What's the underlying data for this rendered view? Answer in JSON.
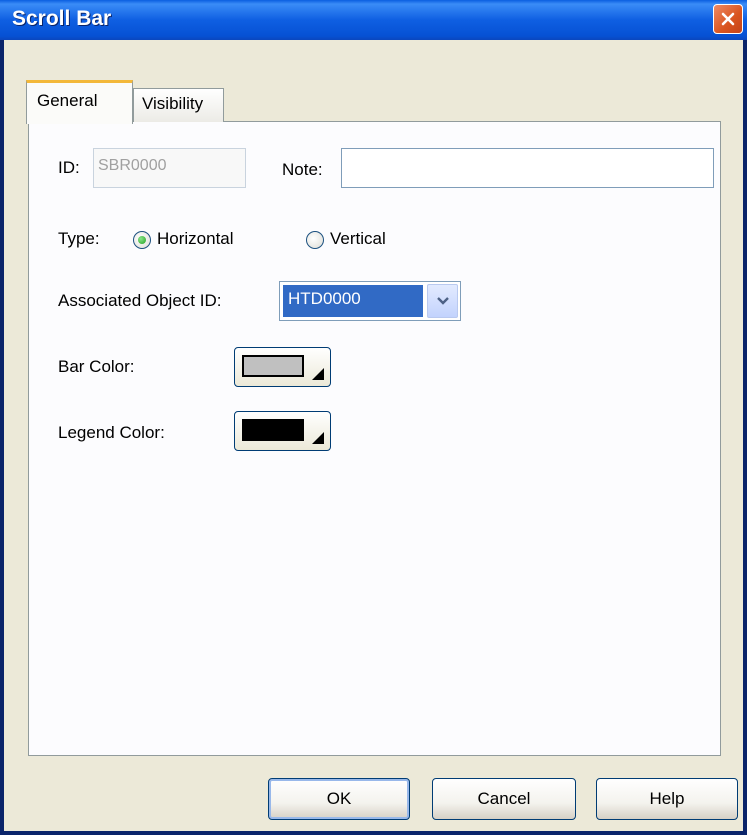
{
  "window": {
    "title": "Scroll Bar"
  },
  "tabs": [
    {
      "label": "General",
      "selected": true
    },
    {
      "label": "Visibility",
      "selected": false
    }
  ],
  "general": {
    "id_label": "ID:",
    "id_value": "SBR0000",
    "note_label": "Note:",
    "note_value": "",
    "type_label": "Type:",
    "type_options": [
      {
        "label": "Horizontal",
        "checked": true
      },
      {
        "label": "Vertical",
        "checked": false
      }
    ],
    "assoc_label": "Associated Object ID:",
    "assoc_value": "HTD0000",
    "bar_color_label": "Bar Color:",
    "bar_color": "#c0c0c0",
    "legend_color_label": "Legend Color:",
    "legend_color": "#000000"
  },
  "buttons": {
    "ok": "OK",
    "cancel": "Cancel",
    "help": "Help"
  },
  "colors": {
    "titlebar": "#0a5ee0",
    "close": "#d9541f",
    "selection": "#316ac5",
    "tab_highlight": "#f3b83a"
  }
}
